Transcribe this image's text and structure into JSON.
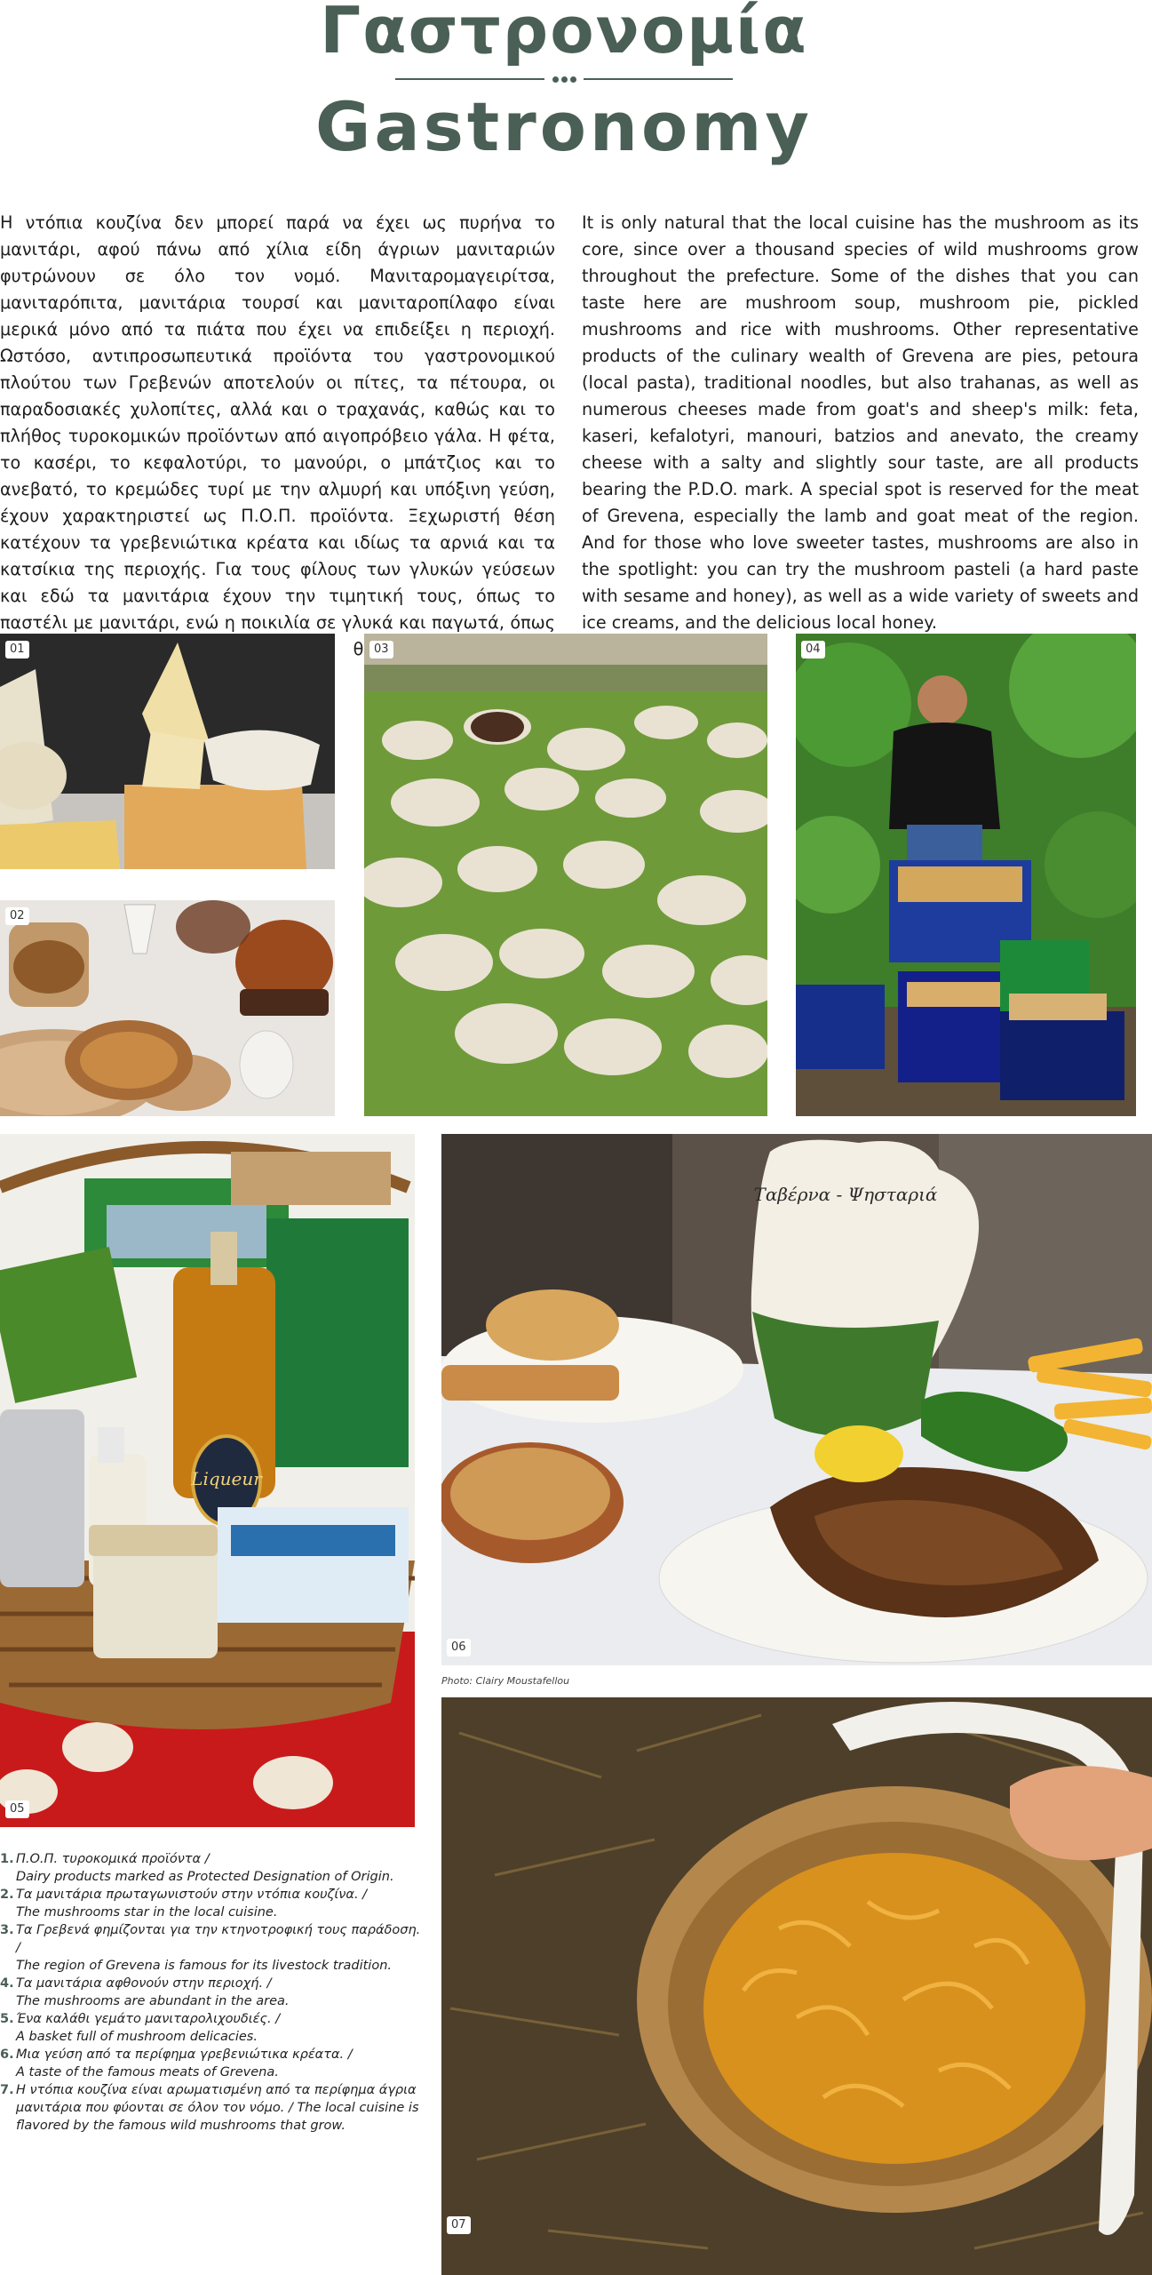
{
  "header": {
    "title_greek": "Γαστρονομία",
    "title_english": "Gastronomy"
  },
  "body_text": {
    "greek": "Η ντόπια κουζίνα δεν μπορεί παρά να έχει ως πυρήνα το μανιτάρι, αφού πάνω από χίλια είδη άγριων μανιταριών φυτρώνουν σε όλο τον νομό. Μανιταρομαγειρίτσα, μανιταρόπιτα, μανιτάρια τουρσί και μανιταροπίλαφο είναι μερικά μόνο από τα πιάτα που έχει να επιδείξει η περιοχή. Ωστόσο, αντιπροσωπευτικά προϊόντα του γαστρονομικού πλούτου των Γρεβενών αποτελούν οι πίτες, τα πέτουρα, οι παραδοσιακές χυλοπίτες, αλλά και ο τραχανάς, καθώς και το πλήθος τυροκομικών προϊόντων από αιγοπρόβειο γάλα. Η φέτα, το κασέρι, το κεφαλοτύρι, το μανούρι, ο μπάτζιος και το ανεβατό, το κρεμώδες τυρί με την αλμυρή και υπόξινη γεύση, έχουν χαρακτηριστεί ως Π.Ο.Π. προϊόντα. Ξεχωριστή θέση κατέχουν τα γρεβενιώτικα κρέατα και ιδίως τα αρνιά και τα κατσίκια της περιοχής. Για τους φίλους των γλυκών γεύσεων και εδώ τα μανιτάρια έχουν την τιμητική τους, όπως το παστέλι με μανιτάρι, ενώ η ποικιλία σε γλυκά και παγωτά, όπως και το εύγεστο ντόπιο μέλι, δεν θα αφήσουν κανέναν ασυγκίνητο.",
    "english": "It is only natural that the local cuisine has the mushroom as its core, since over a thousand species of wild mushrooms grow throughout the prefecture. Some of the dishes that you can taste here are mushroom soup, mushroom pie, pickled mushrooms and rice with mushrooms. Other representative products of the culinary wealth of Grevena are pies, petoura (local pasta), traditional noodles, but also trahanas, as well as numerous cheeses made from goat's and sheep's milk: feta, kaseri, kefalotyri, manouri, batzios and anevato, the creamy cheese with a salty and slightly sour taste, are all products bearing the P.D.O. mark. A special spot is reserved for the meat of Grevena, especially the lamb and goat meat of the region. And for those who love sweeter tastes, mushrooms are also in the spotlight: you can try the mushroom pasteli (a hard paste with sesame and honey), as well as a wide variety of sweets and ice creams, and the delicious local honey."
  },
  "photos": {
    "p01": "01",
    "p02": "02",
    "p03": "03",
    "p04": "04",
    "p05": "05",
    "p06": "06",
    "p07": "07",
    "basket_bottle_label": "Liqueur",
    "jug_text": "Ταβέρνα - Ψησταριά"
  },
  "photo_credit": "Photo: Clairy Moustafellou",
  "captions": [
    {
      "n": "1.",
      "gr": "Π.Ο.Π. τυροκομικά προϊόντα /",
      "en": "Dairy products marked as Protected Designation of Origin."
    },
    {
      "n": "2.",
      "gr": "Τα μανιτάρια πρωταγωνιστούν στην ντόπια κουζίνα. /",
      "en": "The mushrooms star in the local cuisine."
    },
    {
      "n": "3.",
      "gr": "Τα Γρεβενά φημίζονται για την κτηνοτροφική τους παράδοση. /",
      "en": "The region of Grevena is famous for its livestock tradition."
    },
    {
      "n": "4.",
      "gr": "Τα μανιτάρια αφθονούν στην περιοχή. /",
      "en": "The mushrooms are abundant in the area."
    },
    {
      "n": "5.",
      "gr": "Ένα καλάθι γεμάτο μανιταρολιχουδιές. /",
      "en": "A basket full of mushroom delicacies."
    },
    {
      "n": "6.",
      "gr": "Μια γεύση από τα περίφημα γρεβενιώτικα κρέατα. /",
      "en": "A taste of the famous meats of Grevena."
    },
    {
      "n": "7.",
      "gr": "Η ντόπια κουζίνα είναι αρωματισμένη από τα περίφημα άγρια μανιτάρια που φύονται σε όλον τον νόμο. / The local cuisine is flavored by the famous wild mushrooms that grow.",
      "en": ""
    }
  ]
}
